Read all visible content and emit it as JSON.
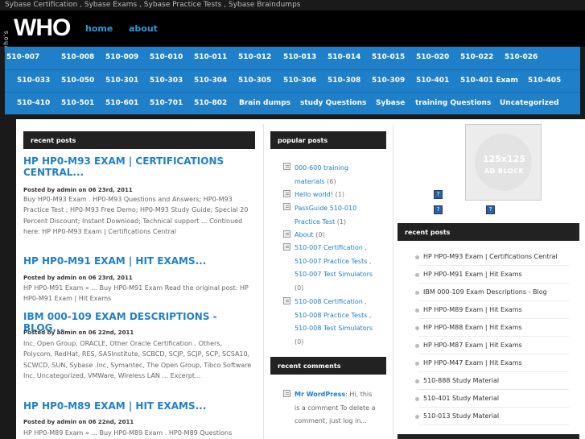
{
  "site": {
    "tagline": "Sybase Certification , Sybase Exams , Sybase Practice Tests , Sybase Braindumps",
    "logo_small": "who's",
    "logo_big": "WHO"
  },
  "nav": {
    "home": "home",
    "about": "about"
  },
  "categories": {
    "row1": [
      "510-007",
      "510-008",
      "510-009",
      "510-010",
      "510-011",
      "510-012",
      "510-013",
      "510-014",
      "510-015",
      "510-020",
      "510-022",
      "510-026"
    ],
    "row2": [
      "510-033",
      "510-050",
      "510-301",
      "510-303",
      "510-304",
      "510-305",
      "510-306",
      "510-308",
      "510-309",
      "510-401",
      "510-401 Exam",
      "510-405"
    ],
    "row3": [
      "510-410",
      "510-501",
      "510-601",
      "510-701",
      "510-802",
      "Brain dumps",
      "study Questions",
      "Sybase",
      "training Questions",
      "Uncategorized"
    ]
  },
  "recent": {
    "title": "recent posts",
    "posts": [
      {
        "title": "HP HP0-M93 EXAM | CERTIFICATIONS CENTRAL...",
        "meta": "Posted by admin on 06 23rd, 2011",
        "body": "Buy HP0-M93 Exam . HP0-M93 Questions and Answers; HP0-M93 Practice Test ; HP0-M93 Free Demo; HP0-M93 Study Guide; Special 20 Percent Discount; Instant Download; Technical support ... Continued here: HP HP0-M93 Exam | Certifications Central"
      },
      {
        "title": "HP HP0-M91 EXAM | HIT EXAMS...",
        "meta": "Posted by admin on 06 23rd, 2011",
        "body": "HP HP0-M91 Exam » ... Buy HP0-M91 Exam Read the original post: HP HP0-M91 Exam | Hit Exams"
      },
      {
        "title": "IBM 000-109 EXAM DESCRIPTIONS - BLOG...",
        "meta": "Posted by admin on 06 22nd, 2011",
        "body": "Inc, Open Group, ORACLE, Other Oracle Certification , Others, Polycom, RedHat, RES, SASInstitute, SCBCD, SCJP, SCJP, SCP, SCSA10, SCWCD, SUN, Sybase .Inc, Symantec, The Open Group, Tibco Software Inc, Uncategorized, VMWare, Wireless LAN ... Excerpt..."
      },
      {
        "title": "HP HP0-M89 EXAM | HIT EXAMS...",
        "meta": "Posted by admin on 06 22nd, 2011",
        "body": "HP HP0-M89 Exam » ... Buy HP0-M89 Exam . HP0-M89 Questions"
      }
    ]
  },
  "popular": {
    "title": "popular posts",
    "items": [
      {
        "line1": "000-600 training",
        "line2": "materials",
        "count": "(6)"
      },
      {
        "line1": "Hello world!",
        "line2": "",
        "count": "(1)"
      },
      {
        "line1": "PassGuide 510-010",
        "line2": "Practice Test",
        "count": "(1)"
      },
      {
        "line1": "About",
        "line2": "",
        "count": "(0)"
      },
      {
        "line1": "510-007 Certification ,",
        "line2": "510-007 Practice Tests ,",
        "line3": "510-007 Test Simulators",
        "count": "(0)"
      },
      {
        "line1": "510-008 Certification ,",
        "line2": "510-008 Practice Tests ,",
        "line3": "510-008 Test Simulators",
        "count": "(0)"
      }
    ]
  },
  "comments": {
    "title": "recent comments",
    "author": "Mr WordPress",
    "text1": ": Hi, this",
    "text2": "is a comment To delete a",
    "text3": "comment, just log in..."
  },
  "ad": {
    "size": "125x125",
    "label": "AD BLOCK",
    "icon_text": "?"
  },
  "sidebar_recent": {
    "title": "recent posts",
    "items": [
      "HP HP0-M93 Exam | Certifications Central",
      "HP HP0-M91 Exam | Hit Exams",
      "IBM 000-109 Exam Descriptions - Blog",
      "HP HP0-M89 Exam | Hit Exams",
      "HP HP0-M88 Exam | Hit Exams",
      "HP HP0-M87 Exam | Hit Exams",
      "HP HP0-M47 Exam | Hit Exams",
      "510-888 Study Material",
      "510-401 Study Material",
      "510-013 Study Material"
    ]
  }
}
